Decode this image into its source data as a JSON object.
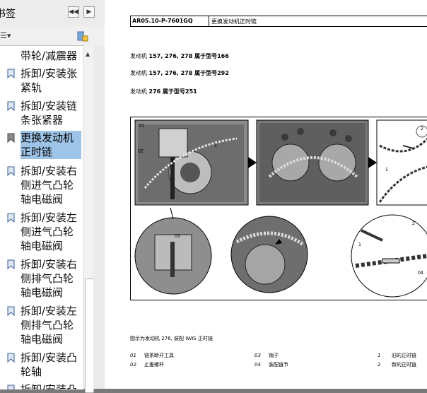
{
  "sidebar": {
    "title": "书签",
    "nav_prev": "◀◀",
    "nav_next": "▶",
    "options_label": "☰▾",
    "items": [
      {
        "label": "带轮/减震器",
        "selected": false
      },
      {
        "label": "拆卸/安装张紧轨",
        "selected": false
      },
      {
        "label": "拆卸/安装链条张紧器",
        "selected": false
      },
      {
        "label": "更换发动机正时链",
        "selected": true
      },
      {
        "label": "拆卸/安装右侧进气凸轮轴电磁阀",
        "selected": false
      },
      {
        "label": "拆卸/安装左侧进气凸轮轴电磁阀",
        "selected": false
      },
      {
        "label": "拆卸/安装右侧排气凸轮轴电磁阀",
        "selected": false
      },
      {
        "label": "拆卸/安装左侧排气凸轮轴电磁阀",
        "selected": false
      },
      {
        "label": "拆卸/安装凸轮轴",
        "selected": false
      },
      {
        "label": "拆卸/安装凸",
        "selected": false
      }
    ]
  },
  "document": {
    "header_code": "AR05.10-P-7601GQ",
    "header_title": "更换发动机正时链",
    "applicability": [
      {
        "prefix": "发动机",
        "models": "157, 276, 278 属于型号166"
      },
      {
        "prefix": "发动机",
        "models": "157, 276, 278 属于型号292"
      },
      {
        "prefix": "发动机",
        "models": "276 属于型号251"
      }
    ],
    "caption": "图示为发动机 276, 装配 IWIS 正时链",
    "legend": [
      {
        "num": "01",
        "text": "链条断开工具"
      },
      {
        "num": "02",
        "text": "止推螺杆"
      },
      {
        "num": "03",
        "text": "销子"
      },
      {
        "num": "04",
        "text": "装配链节"
      },
      {
        "num": "1",
        "text": "旧的正时链"
      },
      {
        "num": "2",
        "text": "新的正时链"
      }
    ],
    "figure_callouts": [
      "01",
      "02",
      "1",
      "03",
      "1",
      "2",
      "04",
      "2",
      "1"
    ]
  }
}
